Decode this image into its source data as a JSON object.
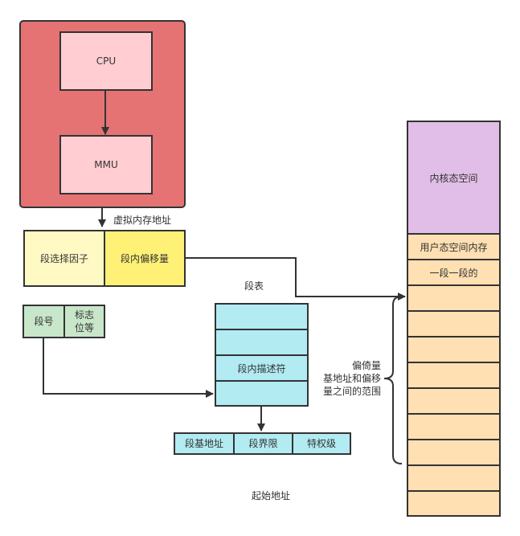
{
  "diagram": {
    "cpu_container": {
      "cpu_label": "CPU",
      "mmu_label": "MMU"
    },
    "virtual_address_label": "虚拟内存地址",
    "virtual_address": {
      "selector_label": "段选择因子",
      "offset_label": "段内偏移量"
    },
    "selector_fields": {
      "segment_number_label": "段号",
      "flags_label": "标志\n位等"
    },
    "segment_table": {
      "title": "段表",
      "rows": [
        "",
        "",
        "段内描述符",
        ""
      ]
    },
    "descriptor_fields": [
      "段基地址",
      "段界限",
      "特权级"
    ],
    "start_address_label": "起始地址",
    "offset_brace_label": [
      "偏倚量",
      "基地址和偏移",
      "量之间的范围"
    ],
    "memory": {
      "kernel_label": "内核态空间",
      "rows": [
        "用户态空间内存",
        "一段一段的",
        "",
        "",
        "",
        "",
        "",
        "",
        "",
        "",
        ""
      ]
    },
    "colors": {
      "cpu_container": "#e57373",
      "cpu_box": "#ffcdd2",
      "selector": "#fff9c4",
      "offset": "#fff176",
      "green": "#c8e6c9",
      "cyan": "#b2ebf2",
      "kernel": "#e1bee7",
      "user_memory": "#ffe0b2",
      "stroke": "#333333"
    }
  }
}
